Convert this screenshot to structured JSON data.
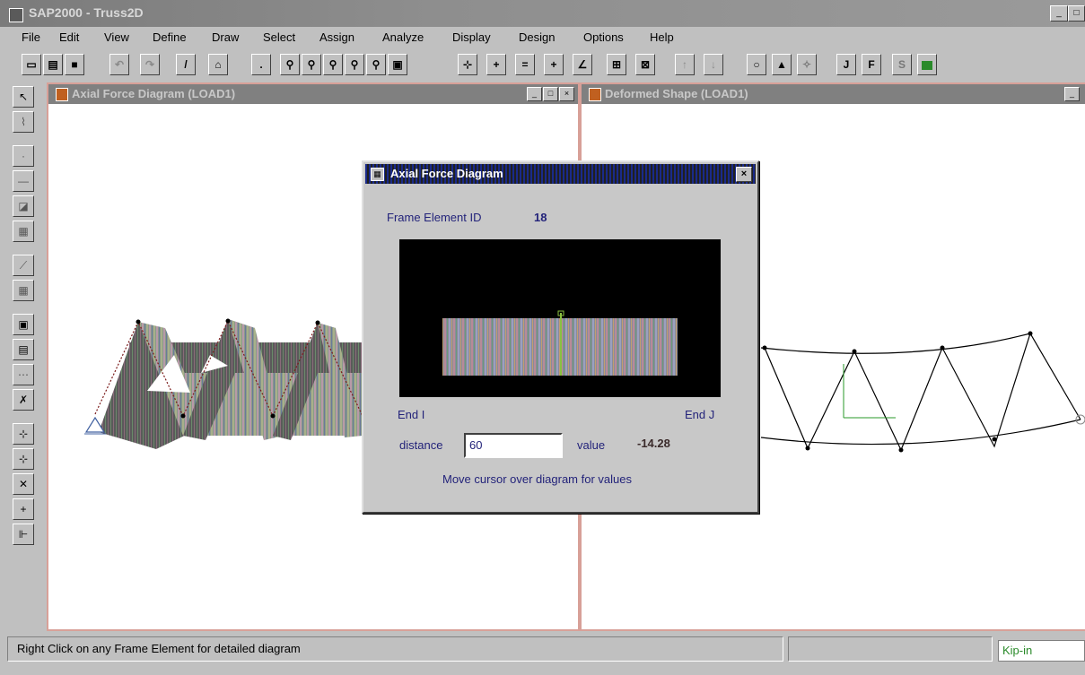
{
  "app": {
    "title": "SAP2000 - Truss2D"
  },
  "menu": [
    "File",
    "Edit",
    "View",
    "Define",
    "Draw",
    "Select",
    "Assign",
    "Analyze",
    "Display",
    "Design",
    "Options",
    "Help"
  ],
  "panes": {
    "left_title": "Axial Force Diagram   (LOAD1)",
    "right_title": "Deformed Shape (LOAD1)"
  },
  "dialog": {
    "title": "Axial Force Diagram",
    "element_label": "Frame Element ID",
    "element_id": "18",
    "end_i": "End I",
    "end_j": "End J",
    "distance_label": "distance",
    "distance_value": "60",
    "value_label": "value",
    "value": "-14.28",
    "hint": "Move cursor over diagram for values"
  },
  "status": {
    "message": "Right Click on any Frame Element for detailed diagram",
    "units": "Kip-in"
  },
  "colors": {
    "titlebar": "#808080",
    "dialog_title": "#1a2a8a",
    "pane_border": "#d8a098",
    "units_text": "#2a8a2a"
  },
  "icons": {
    "toolbar": [
      "new-icon",
      "open-icon",
      "save-icon",
      "undo-icon",
      "redo-icon",
      "pencil-icon",
      "refresh-icon",
      "pointer-icon",
      "zoom-window-icon",
      "zoom-in-icon",
      "zoom-out-icon",
      "zoom-restore-icon",
      "pan-icon",
      "3d-view-icon",
      "xy-view-icon",
      "xz-view-icon",
      "yz-view-icon",
      "nv-view-icon",
      "perspective-icon",
      "object-shrink-icon",
      "set-elements-icon",
      "up-arrow-icon",
      "down-arrow-icon",
      "run-analysis-icon",
      "show-undeformed-icon",
      "show-loads-icon",
      "show-deformed-icon",
      "show-forces-icon",
      "show-stresses-icon",
      "show-grid-icon"
    ]
  }
}
